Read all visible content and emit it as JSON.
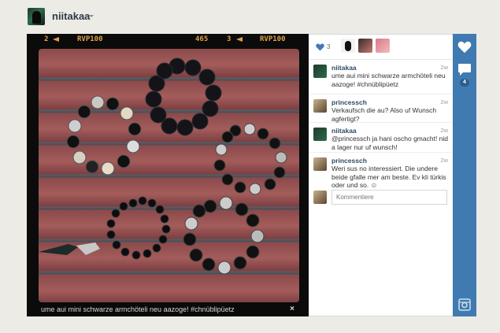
{
  "header": {
    "username": "niitakaa"
  },
  "photo": {
    "hud": {
      "left_num": "2",
      "left_code": "RVP100",
      "mid_num": "465",
      "right_num": "3",
      "right_code": "RVP100"
    },
    "caption": "ume aui mini schwarze armchöteli neu aazoge! #chnüblipüetz",
    "close_glyph": "×"
  },
  "likes": {
    "count": "3",
    "icon": "heart-icon"
  },
  "comments": [
    {
      "user": "niitakaa",
      "time": "2w",
      "text": "ume aui mini schwarze armchöteli neu aazoge! #chnüblipüetz"
    },
    {
      "user": "princessch",
      "time": "2w",
      "text": "Verkaufsch die au? Also uf Wunsch agfertigt?"
    },
    {
      "user": "niitakaa",
      "time": "2w",
      "text": "@princessch ja hani oscho gmacht! nid a lager nur uf wunsch!"
    },
    {
      "user": "princessch",
      "time": "2w",
      "text": "Weri sus no interessiert. Die undere beide gfalle mer am beste. Ev kli türkis oder und so. ☺"
    }
  ],
  "comment_input": {
    "placeholder": "Kommentiere"
  },
  "action_bar": {
    "comment_count": "4",
    "icons": [
      "heart-icon",
      "comment-icon",
      "camera-icon"
    ]
  },
  "colors": {
    "accent": "#3f7bb1",
    "background": "#ecebe6",
    "hud": "#e0a24a",
    "username_link": "#2e4b66"
  }
}
